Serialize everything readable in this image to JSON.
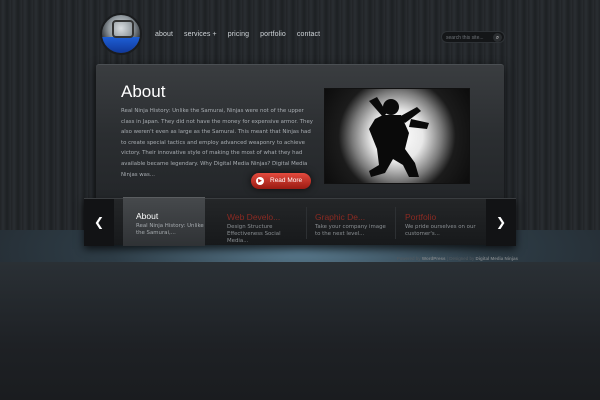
{
  "nav": {
    "items": [
      {
        "label": "about"
      },
      {
        "label": "services +"
      },
      {
        "label": "pricing"
      },
      {
        "label": "portfolio"
      },
      {
        "label": "contact"
      }
    ]
  },
  "search": {
    "placeholder": "search this site...",
    "button_icon": "magnifier-icon"
  },
  "feature": {
    "title": "About",
    "body": "Real Ninja History: Unlike the Samurai, Ninjas were not of the upper class in Japan. They did not have the money for expensive armor. They also weren't even as large as the Samurai. This meant that Ninjas had to create special tactics and employ advanced weaponry to achieve victory. Their innovative style of making the most of what they had available became legendary. Why Digital Media Ninjas? Digital Media Ninjas was...",
    "read_more": "Read More",
    "image_icon": "ninja-silhouette"
  },
  "slider": {
    "items": [
      {
        "title": "About",
        "desc": "Real Ninja History: Unlike the Samurai,...",
        "active": true
      },
      {
        "title": "Web Develo...",
        "desc": "Design Structure Effectiveness Social Media...",
        "active": false
      },
      {
        "title": "Graphic De...",
        "desc": "Take your company image to the next level...",
        "active": false
      },
      {
        "title": "Portfolio",
        "desc": "We pride ourselves on our customer's...",
        "active": false
      }
    ]
  },
  "footer": {
    "powered_prefix": "Powered by",
    "powered_name": "WordPress",
    "designed_prefix": "| Designed by",
    "designed_name": "Digital Media Ninjas"
  },
  "colors": {
    "accent_red": "#c2281d",
    "inactive_title": "#8b2a22"
  }
}
